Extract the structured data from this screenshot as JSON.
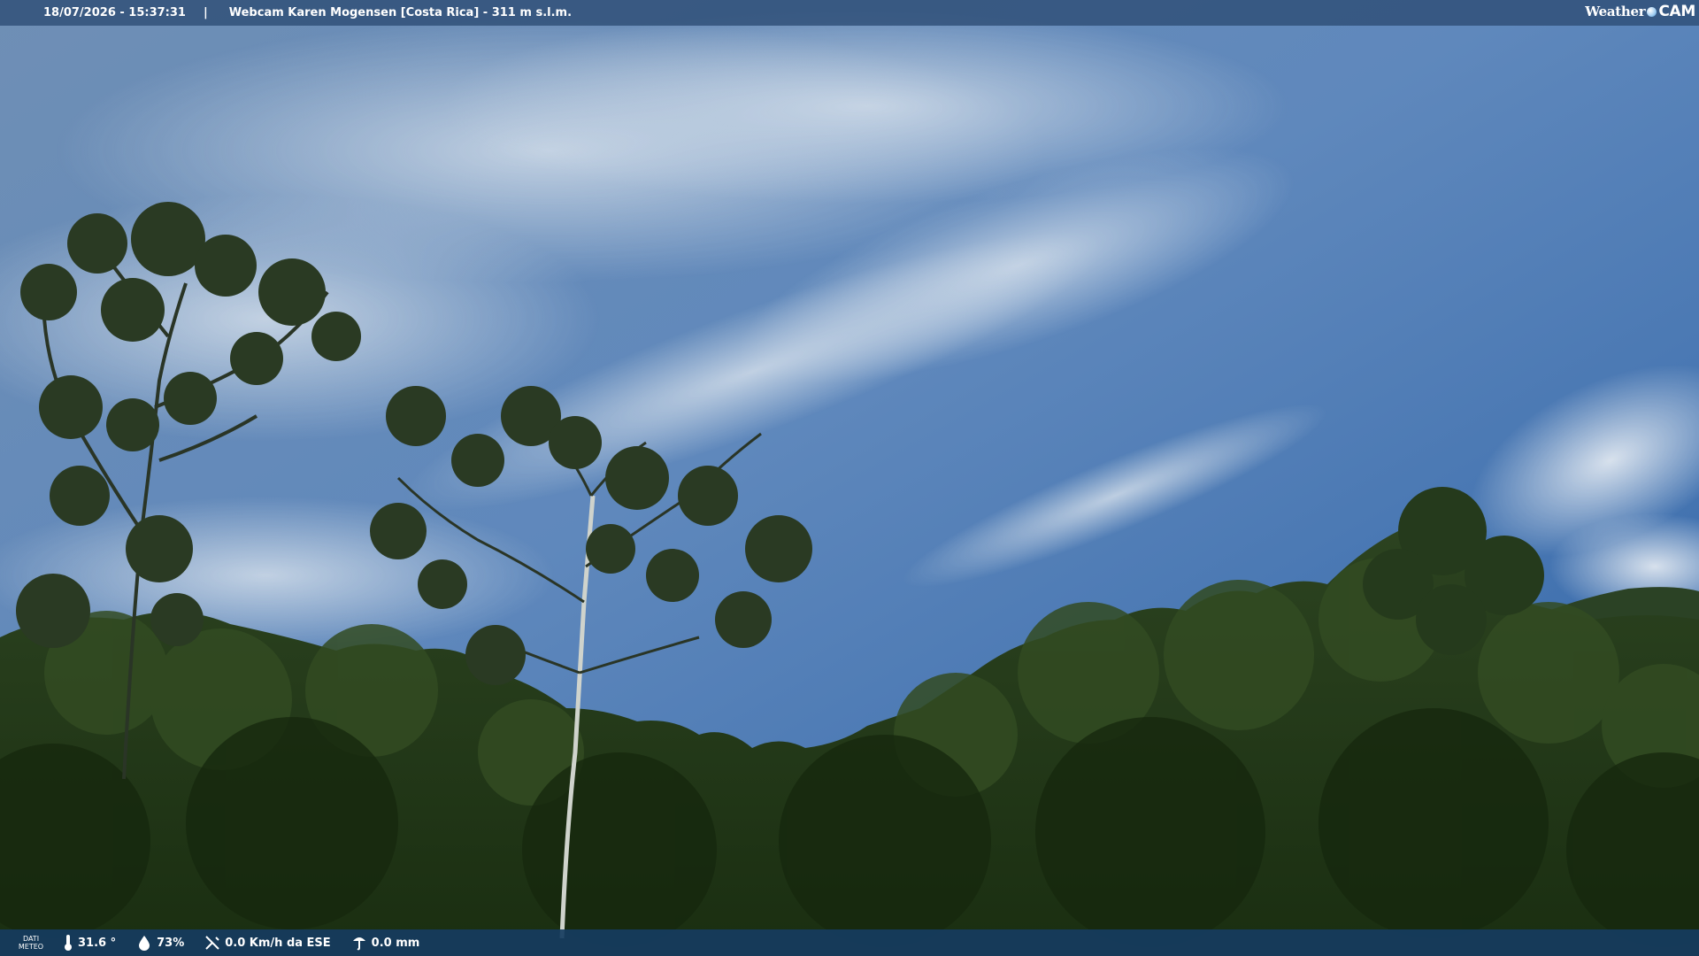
{
  "overlay": {
    "datetime": "18/07/2026 - 15:37:31",
    "separator": "|",
    "location": "Webcam Karen Mogensen [Costa Rica]  - 311 m s.l.m.",
    "logo": {
      "part1": "Weather",
      "part2": "CAM"
    }
  },
  "weather_bar": {
    "label_line1": "DATI",
    "label_line2": "METEO",
    "temperature": "31.6 °",
    "humidity": "73%",
    "wind": "0.0 Km/h da ESE",
    "rain": "0.0 mm",
    "icons": [
      "thermometer-icon",
      "humidity-drop-icon",
      "wind-icon",
      "rain-gauge-icon"
    ]
  },
  "scene": {
    "sky_colors": [
      "#3a6aa6",
      "#5d86b8",
      "#9fb5cf"
    ],
    "foliage_colors": [
      "#14260e",
      "#22381a",
      "#324b22"
    ]
  }
}
